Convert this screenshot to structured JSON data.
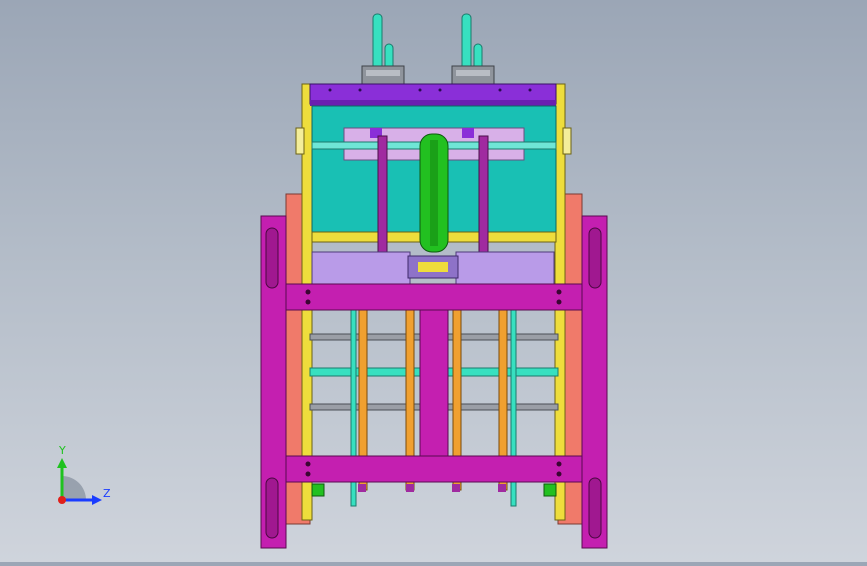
{
  "viewport": {
    "background_top": "#9ba6b6",
    "background_bottom": "#cfd4dc"
  },
  "triad": {
    "y_label": "Y",
    "z_label": "Z",
    "y_color": "#1fc21f",
    "z_color": "#1a3cff",
    "x_color": "#e0201a"
  },
  "colors": {
    "magenta_frame": "#c41fb0",
    "salmon_panel": "#f07a6a",
    "yellow_rail": "#eedd3c",
    "teal_plate": "#19c0b4",
    "purple_top": "#8a2fd8",
    "green_belt": "#22c020",
    "cyan_rod": "#37e0c0",
    "orange_rod": "#f0a030",
    "lavender_block": "#b99be8",
    "steel": "#9a9ea6"
  }
}
